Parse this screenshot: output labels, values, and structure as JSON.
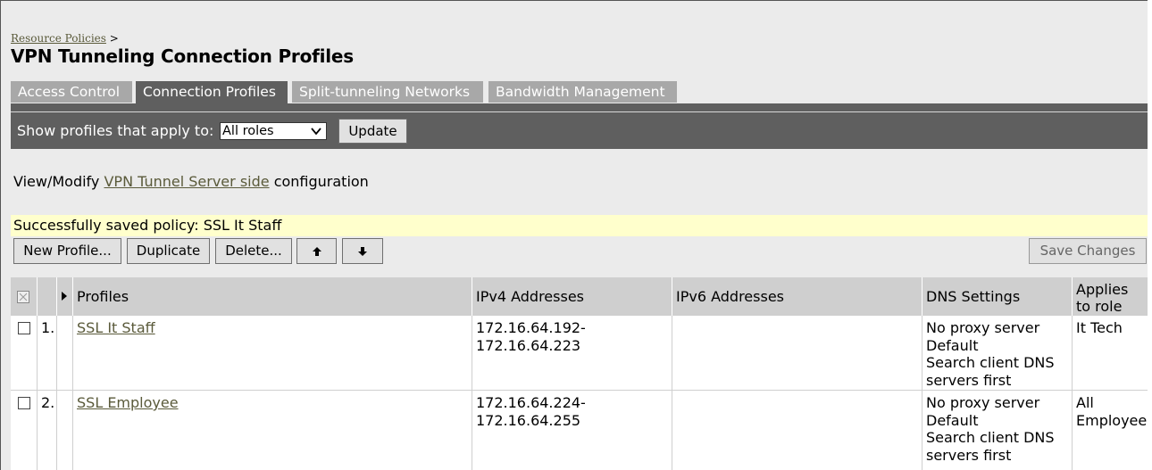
{
  "breadcrumb": {
    "link": "Resource Policies",
    "sep": ">"
  },
  "page_title": "VPN Tunneling Connection Profiles",
  "tabs": [
    {
      "label": "Access Control",
      "active": false
    },
    {
      "label": "Connection Profiles",
      "active": true
    },
    {
      "label": "Split-tunneling Networks",
      "active": false
    },
    {
      "label": "Bandwidth Management",
      "active": false
    }
  ],
  "filter": {
    "label": "Show profiles that apply to:",
    "selected": "All roles",
    "update_label": "Update"
  },
  "view_modify": {
    "prefix": "View/Modify",
    "link": "VPN Tunnel Server side",
    "suffix": "configuration"
  },
  "status_message": "Successfully saved policy: SSL It Staff",
  "toolbar": {
    "new_label": "New Profile...",
    "duplicate_label": "Duplicate",
    "delete_label": "Delete...",
    "save_label": "Save Changes"
  },
  "table": {
    "headers": {
      "profiles": "Profiles",
      "ipv4": "IPv4 Addresses",
      "ipv6": "IPv6 Addresses",
      "dns": "DNS Settings",
      "roles_1": "Applies",
      "roles_2": "to role"
    },
    "rows": [
      {
        "num": "1.",
        "name": "SSL It Staff",
        "ipv4_1": "172.16.64.192-",
        "ipv4_2": "172.16.64.223",
        "ipv6": "",
        "dns_1": "No proxy server",
        "dns_2": "Default",
        "dns_3": "Search client DNS",
        "dns_4": "servers first",
        "role_1": "It Tech",
        "role_2": ""
      },
      {
        "num": "2.",
        "name": "SSL Employee",
        "ipv4_1": "172.16.64.224-",
        "ipv4_2": "172.16.64.255",
        "ipv6": "",
        "dns_1": "No proxy server",
        "dns_2": "Default",
        "dns_3": "Search client DNS",
        "dns_4": "servers first",
        "role_1": "All",
        "role_2": "Employee"
      }
    ]
  },
  "colors": {
    "tab_inactive": "#a8a8a8",
    "tab_active": "#5f5f5f",
    "success_bg": "#ffffcc",
    "link": "#5a5a3a",
    "header_bg": "#cfcfcf"
  }
}
